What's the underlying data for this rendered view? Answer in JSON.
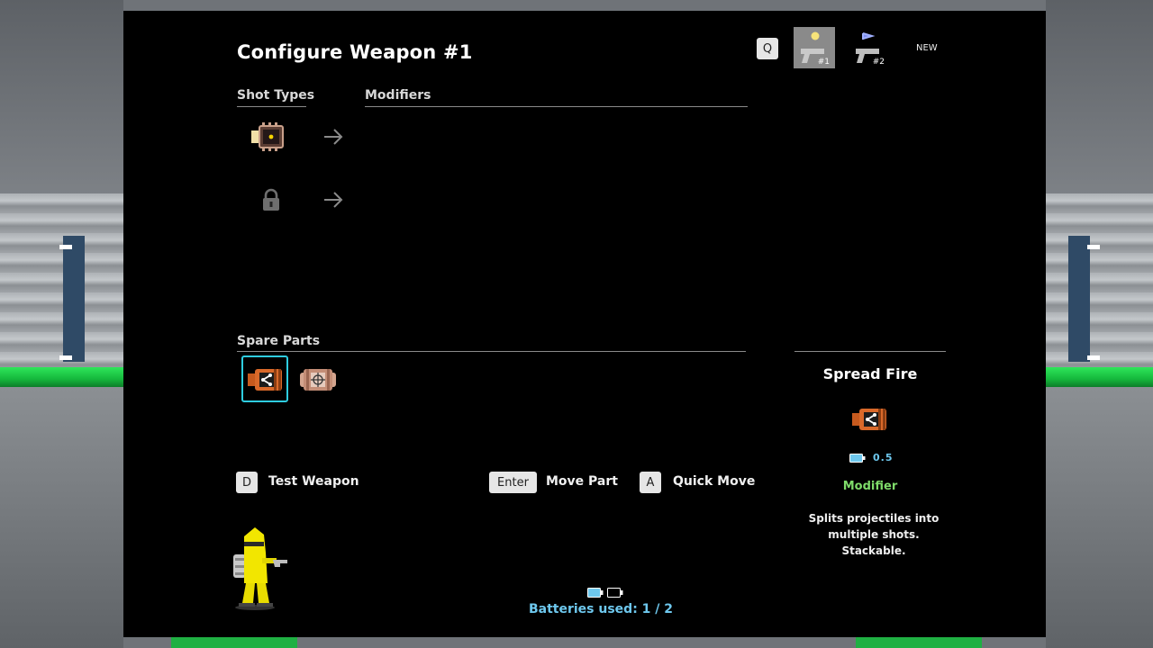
{
  "screen": {
    "title": "Configure Weapon #1",
    "section_shot_types": "Shot Types",
    "section_modifiers": "Modifiers",
    "section_spare_parts": "Spare Parts"
  },
  "weapon_tabs": {
    "switch_key": "Q",
    "slots": [
      {
        "number": "#1",
        "active": true,
        "icon": "pistol-icon"
      },
      {
        "number": "#2",
        "active": false,
        "icon": "pistol-icon"
      }
    ],
    "new_label": "NEW"
  },
  "shot_types": [
    {
      "icon": "shot-chip-icon",
      "locked": false
    },
    {
      "icon": "lock-icon",
      "locked": true
    }
  ],
  "spare_parts": [
    {
      "name": "Spread Fire",
      "icon": "spread-fire-part-icon",
      "selected": true
    },
    {
      "icon": "crosshair-part-icon",
      "selected": false
    }
  ],
  "controls": {
    "test_key": "D",
    "test_label": "Test Weapon",
    "move_key": "Enter",
    "move_label": "Move Part",
    "quick_key": "A",
    "quick_label": "Quick Move"
  },
  "part_info": {
    "name": "Spread Fire",
    "cost": "0.5",
    "type": "Modifier",
    "description_line1": "Splits projectiles into",
    "description_line2": "multiple shots. Stackable."
  },
  "batteries": {
    "label": "Batteries used: 1 / 2",
    "used": 1,
    "total": 2
  },
  "colors": {
    "accent_cyan": "#2ecde0",
    "battery_blue": "#6ec8ee",
    "modifier_green": "#7fdc6a",
    "robot_yellow": "#f2e600"
  }
}
